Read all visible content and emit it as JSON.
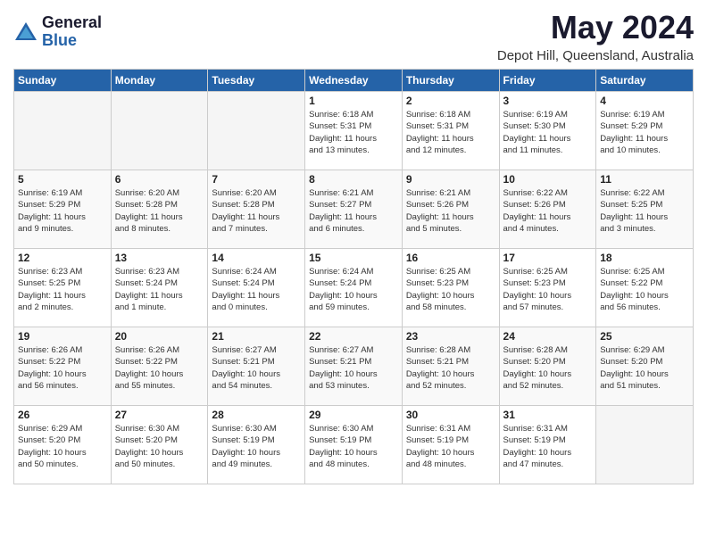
{
  "header": {
    "logo_general": "General",
    "logo_blue": "Blue",
    "month_year": "May 2024",
    "location": "Depot Hill, Queensland, Australia"
  },
  "weekdays": [
    "Sunday",
    "Monday",
    "Tuesday",
    "Wednesday",
    "Thursday",
    "Friday",
    "Saturday"
  ],
  "weeks": [
    [
      {
        "day": "",
        "info": ""
      },
      {
        "day": "",
        "info": ""
      },
      {
        "day": "",
        "info": ""
      },
      {
        "day": "1",
        "info": "Sunrise: 6:18 AM\nSunset: 5:31 PM\nDaylight: 11 hours\nand 13 minutes."
      },
      {
        "day": "2",
        "info": "Sunrise: 6:18 AM\nSunset: 5:31 PM\nDaylight: 11 hours\nand 12 minutes."
      },
      {
        "day": "3",
        "info": "Sunrise: 6:19 AM\nSunset: 5:30 PM\nDaylight: 11 hours\nand 11 minutes."
      },
      {
        "day": "4",
        "info": "Sunrise: 6:19 AM\nSunset: 5:29 PM\nDaylight: 11 hours\nand 10 minutes."
      }
    ],
    [
      {
        "day": "5",
        "info": "Sunrise: 6:19 AM\nSunset: 5:29 PM\nDaylight: 11 hours\nand 9 minutes."
      },
      {
        "day": "6",
        "info": "Sunrise: 6:20 AM\nSunset: 5:28 PM\nDaylight: 11 hours\nand 8 minutes."
      },
      {
        "day": "7",
        "info": "Sunrise: 6:20 AM\nSunset: 5:28 PM\nDaylight: 11 hours\nand 7 minutes."
      },
      {
        "day": "8",
        "info": "Sunrise: 6:21 AM\nSunset: 5:27 PM\nDaylight: 11 hours\nand 6 minutes."
      },
      {
        "day": "9",
        "info": "Sunrise: 6:21 AM\nSunset: 5:26 PM\nDaylight: 11 hours\nand 5 minutes."
      },
      {
        "day": "10",
        "info": "Sunrise: 6:22 AM\nSunset: 5:26 PM\nDaylight: 11 hours\nand 4 minutes."
      },
      {
        "day": "11",
        "info": "Sunrise: 6:22 AM\nSunset: 5:25 PM\nDaylight: 11 hours\nand 3 minutes."
      }
    ],
    [
      {
        "day": "12",
        "info": "Sunrise: 6:23 AM\nSunset: 5:25 PM\nDaylight: 11 hours\nand 2 minutes."
      },
      {
        "day": "13",
        "info": "Sunrise: 6:23 AM\nSunset: 5:24 PM\nDaylight: 11 hours\nand 1 minute."
      },
      {
        "day": "14",
        "info": "Sunrise: 6:24 AM\nSunset: 5:24 PM\nDaylight: 11 hours\nand 0 minutes."
      },
      {
        "day": "15",
        "info": "Sunrise: 6:24 AM\nSunset: 5:24 PM\nDaylight: 10 hours\nand 59 minutes."
      },
      {
        "day": "16",
        "info": "Sunrise: 6:25 AM\nSunset: 5:23 PM\nDaylight: 10 hours\nand 58 minutes."
      },
      {
        "day": "17",
        "info": "Sunrise: 6:25 AM\nSunset: 5:23 PM\nDaylight: 10 hours\nand 57 minutes."
      },
      {
        "day": "18",
        "info": "Sunrise: 6:25 AM\nSunset: 5:22 PM\nDaylight: 10 hours\nand 56 minutes."
      }
    ],
    [
      {
        "day": "19",
        "info": "Sunrise: 6:26 AM\nSunset: 5:22 PM\nDaylight: 10 hours\nand 56 minutes."
      },
      {
        "day": "20",
        "info": "Sunrise: 6:26 AM\nSunset: 5:22 PM\nDaylight: 10 hours\nand 55 minutes."
      },
      {
        "day": "21",
        "info": "Sunrise: 6:27 AM\nSunset: 5:21 PM\nDaylight: 10 hours\nand 54 minutes."
      },
      {
        "day": "22",
        "info": "Sunrise: 6:27 AM\nSunset: 5:21 PM\nDaylight: 10 hours\nand 53 minutes."
      },
      {
        "day": "23",
        "info": "Sunrise: 6:28 AM\nSunset: 5:21 PM\nDaylight: 10 hours\nand 52 minutes."
      },
      {
        "day": "24",
        "info": "Sunrise: 6:28 AM\nSunset: 5:20 PM\nDaylight: 10 hours\nand 52 minutes."
      },
      {
        "day": "25",
        "info": "Sunrise: 6:29 AM\nSunset: 5:20 PM\nDaylight: 10 hours\nand 51 minutes."
      }
    ],
    [
      {
        "day": "26",
        "info": "Sunrise: 6:29 AM\nSunset: 5:20 PM\nDaylight: 10 hours\nand 50 minutes."
      },
      {
        "day": "27",
        "info": "Sunrise: 6:30 AM\nSunset: 5:20 PM\nDaylight: 10 hours\nand 50 minutes."
      },
      {
        "day": "28",
        "info": "Sunrise: 6:30 AM\nSunset: 5:19 PM\nDaylight: 10 hours\nand 49 minutes."
      },
      {
        "day": "29",
        "info": "Sunrise: 6:30 AM\nSunset: 5:19 PM\nDaylight: 10 hours\nand 48 minutes."
      },
      {
        "day": "30",
        "info": "Sunrise: 6:31 AM\nSunset: 5:19 PM\nDaylight: 10 hours\nand 48 minutes."
      },
      {
        "day": "31",
        "info": "Sunrise: 6:31 AM\nSunset: 5:19 PM\nDaylight: 10 hours\nand 47 minutes."
      },
      {
        "day": "",
        "info": ""
      }
    ]
  ]
}
